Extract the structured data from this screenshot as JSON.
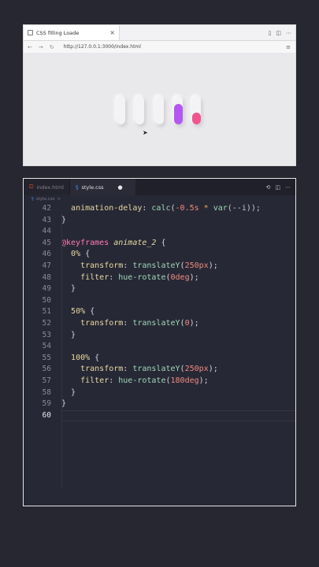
{
  "browser": {
    "tab_title": "CSS filling Loade",
    "tab_close": "×",
    "url": "http://127.0.0.1:3000/index.html",
    "nav_back": "←",
    "nav_forward": "→",
    "nav_reload": "↻",
    "window_icons": [
      "▯",
      "◫",
      "⋯"
    ],
    "menu": "≡",
    "tubes": [
      {
        "fill": 0,
        "color": "#f3f3f5"
      },
      {
        "fill": 0,
        "color": "#f3f3f5"
      },
      {
        "fill": 0,
        "color": "#f3f3f5"
      },
      {
        "fill": 0.72,
        "color": "#b457f0"
      },
      {
        "fill": 0.42,
        "color": "#f0558f"
      }
    ]
  },
  "editor": {
    "tabs": [
      {
        "label": "index.html",
        "icon": "html-file-icon",
        "active": false
      },
      {
        "label": "style.css",
        "icon": "css-file-icon",
        "active": true,
        "modified": "●"
      }
    ],
    "actions": [
      "⟲",
      "◫",
      "⋯"
    ],
    "breadcrumb": {
      "file": "style.css",
      "sep": ">"
    },
    "lines": [
      {
        "n": "42",
        "indent": "  ",
        "tokens": [
          [
            "animation-delay",
            "prop"
          ],
          [
            ": ",
            ""
          ],
          [
            "calc",
            "fn"
          ],
          [
            "(",
            ""
          ],
          [
            "-0.5s",
            "num"
          ],
          [
            " * ",
            "op"
          ],
          [
            "var",
            "fn"
          ],
          [
            "(--i));",
            "var"
          ]
        ]
      },
      {
        "n": "43",
        "indent": "",
        "tokens": [
          [
            "}",
            ""
          ]
        ]
      },
      {
        "n": "44",
        "indent": "",
        "tokens": []
      },
      {
        "n": "45",
        "indent": "",
        "tokens": [
          [
            "@keyframes",
            "kw"
          ],
          [
            " ",
            ""
          ],
          [
            "animate_2",
            "name"
          ],
          [
            " {",
            ""
          ]
        ]
      },
      {
        "n": "46",
        "indent": "  ",
        "tokens": [
          [
            "0%",
            "sel"
          ],
          [
            " {",
            ""
          ]
        ]
      },
      {
        "n": "47",
        "indent": "    ",
        "tokens": [
          [
            "transform",
            "prop"
          ],
          [
            ": ",
            ""
          ],
          [
            "translateY",
            "fn"
          ],
          [
            "(",
            ""
          ],
          [
            "250px",
            "num"
          ],
          [
            ");",
            ""
          ]
        ]
      },
      {
        "n": "48",
        "indent": "    ",
        "tokens": [
          [
            "filter",
            "prop"
          ],
          [
            ": ",
            ""
          ],
          [
            "hue-rotate",
            "fn"
          ],
          [
            "(",
            ""
          ],
          [
            "0deg",
            "num"
          ],
          [
            ");",
            ""
          ]
        ]
      },
      {
        "n": "49",
        "indent": "  ",
        "tokens": [
          [
            "}",
            ""
          ]
        ]
      },
      {
        "n": "50",
        "indent": "",
        "tokens": []
      },
      {
        "n": "51",
        "indent": "  ",
        "tokens": [
          [
            "50%",
            "sel"
          ],
          [
            " {",
            ""
          ]
        ]
      },
      {
        "n": "52",
        "indent": "    ",
        "tokens": [
          [
            "transform",
            "prop"
          ],
          [
            ": ",
            ""
          ],
          [
            "translateY",
            "fn"
          ],
          [
            "(",
            ""
          ],
          [
            "0",
            "num"
          ],
          [
            ");",
            ""
          ]
        ]
      },
      {
        "n": "53",
        "indent": "  ",
        "tokens": [
          [
            "}",
            ""
          ]
        ]
      },
      {
        "n": "54",
        "indent": "",
        "tokens": []
      },
      {
        "n": "55",
        "indent": "  ",
        "tokens": [
          [
            "100%",
            "sel"
          ],
          [
            " {",
            ""
          ]
        ]
      },
      {
        "n": "56",
        "indent": "    ",
        "tokens": [
          [
            "transform",
            "prop"
          ],
          [
            ": ",
            ""
          ],
          [
            "translateY",
            "fn"
          ],
          [
            "(",
            ""
          ],
          [
            "250px",
            "num"
          ],
          [
            ");",
            ""
          ]
        ]
      },
      {
        "n": "57",
        "indent": "    ",
        "tokens": [
          [
            "filter",
            "prop"
          ],
          [
            ": ",
            ""
          ],
          [
            "hue-rotate",
            "fn"
          ],
          [
            "(",
            ""
          ],
          [
            "180deg",
            "num"
          ],
          [
            ");",
            ""
          ]
        ]
      },
      {
        "n": "58",
        "indent": "  ",
        "tokens": [
          [
            "}",
            ""
          ]
        ]
      },
      {
        "n": "59",
        "indent": "",
        "tokens": [
          [
            "}",
            ""
          ]
        ]
      },
      {
        "n": "60",
        "indent": "",
        "tokens": [],
        "current": true
      }
    ]
  }
}
